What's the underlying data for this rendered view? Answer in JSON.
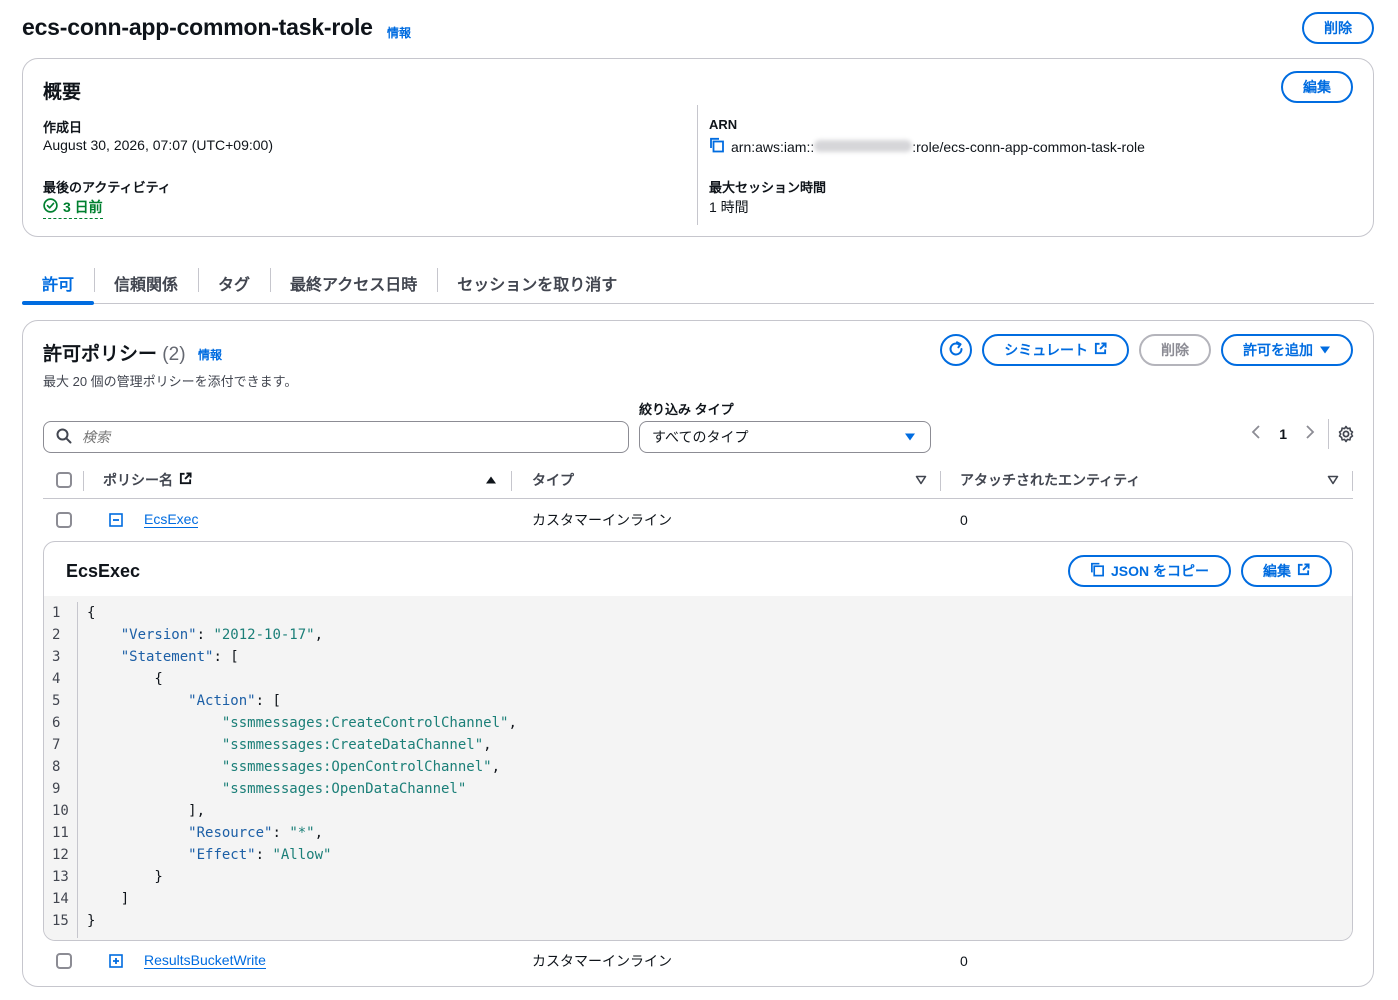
{
  "header": {
    "title": "ecs-conn-app-common-task-role",
    "info": "情報",
    "delete_label": "削除"
  },
  "summary": {
    "title": "概要",
    "edit_label": "編集",
    "created_label": "作成日",
    "created_value": "August 30, 2026, 07:07 (UTC+09:00)",
    "activity_label": "最後のアクティビティ",
    "activity_value": "3 日前",
    "arn_label": "ARN",
    "arn_prefix": "arn:aws:iam::",
    "arn_suffix": ":role/ecs-conn-app-common-task-role",
    "session_label": "最大セッション時間",
    "session_value": "1 時間"
  },
  "tabs": [
    {
      "label": "許可",
      "active": true
    },
    {
      "label": "信頼関係"
    },
    {
      "label": "タグ"
    },
    {
      "label": "最終アクセス日時"
    },
    {
      "label": "セッションを取り消す"
    }
  ],
  "policies": {
    "title": "許可ポリシー",
    "count": "(2)",
    "info": "情報",
    "description": "最大 20 個の管理ポリシーを添付できます。",
    "simulate_label": "シミュレート",
    "delete_label": "削除",
    "add_label": "許可を追加",
    "filter_label": "絞り込み タイプ",
    "search_placeholder": "検索",
    "type_select_value": "すべてのタイプ",
    "page": "1",
    "columns": {
      "name": "ポリシー名",
      "type": "タイプ",
      "entities": "アタッチされたエンティティ"
    },
    "rows": [
      {
        "name": "EcsExec",
        "type": "カスタマーインライン",
        "entities": "0"
      },
      {
        "name": "ResultsBucketWrite",
        "type": "カスタマーインライン",
        "entities": "0"
      }
    ],
    "expanded": {
      "title": "EcsExec",
      "copy_json_label": "JSON をコピー",
      "edit_label": "編集",
      "line_numbers": [
        "1",
        "2",
        "3",
        "4",
        "5",
        "6",
        "7",
        "8",
        "9",
        "10",
        "11",
        "12",
        "13",
        "14",
        "15"
      ]
    }
  },
  "colors": {
    "accent": "#006ce0",
    "success": "#00802f",
    "border": "#c6c6cd",
    "code_bg": "#f4f4f4",
    "json_key": "#1c5fa6",
    "json_string": "#1b7f78"
  }
}
